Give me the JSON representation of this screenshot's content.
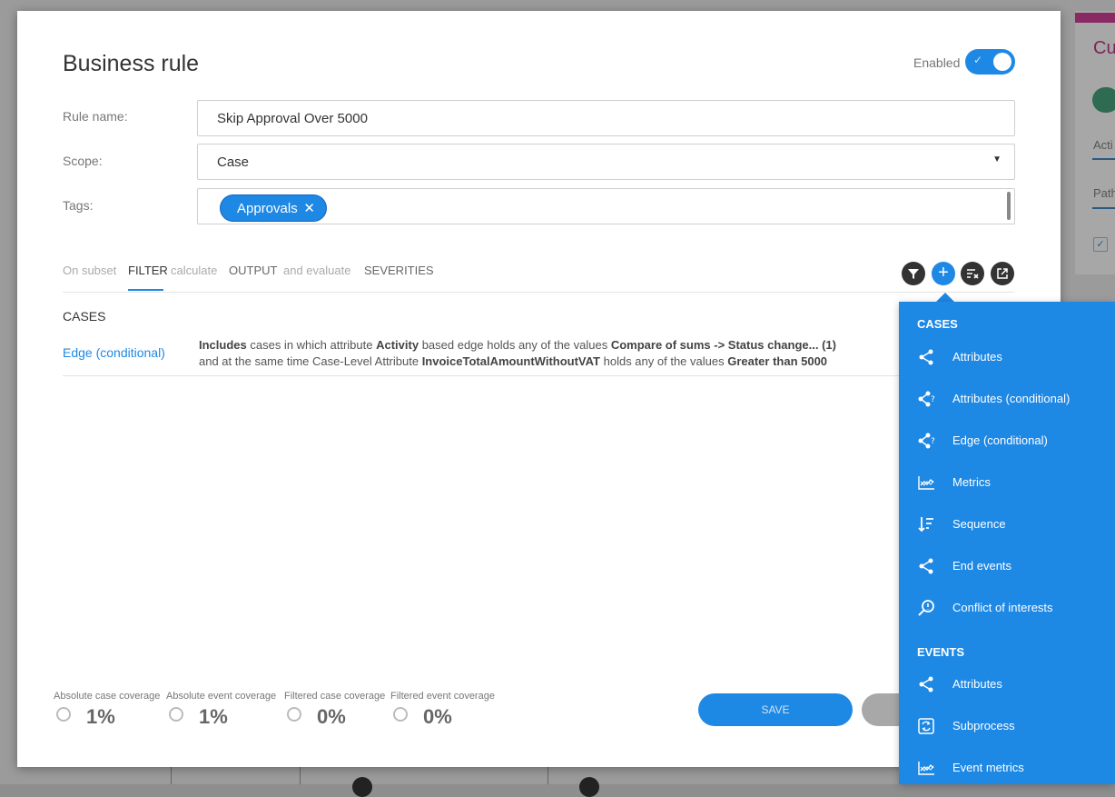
{
  "dialog": {
    "title": "Business rule",
    "enabled_label": "Enabled",
    "enabled": true
  },
  "form": {
    "rule_name_label": "Rule name:",
    "rule_name_value": "Skip Approval Over 5000",
    "scope_label": "Scope:",
    "scope_value": "Case",
    "tags_label": "Tags:",
    "tags": [
      "Approvals"
    ]
  },
  "tabs": [
    "On subset",
    "FILTER",
    "calculate",
    "OUTPUT",
    "and evaluate",
    "SEVERITIES"
  ],
  "active_tab": "FILTER",
  "filter_section": {
    "heading": "CASES",
    "rule": {
      "type_link": "Edge (conditional)",
      "line1": [
        {
          "t": "Includes",
          "b": true
        },
        {
          "t": " cases in which attribute ",
          "b": false
        },
        {
          "t": "Activity",
          "b": true
        },
        {
          "t": " based edge holds any of the values ",
          "b": false
        },
        {
          "t": "Compare of sums -> Status change... (1)",
          "b": true
        }
      ],
      "line2": [
        {
          "t": "and at the same time Case-Level Attribute ",
          "b": false
        },
        {
          "t": "InvoiceTotalAmountWithoutVAT",
          "b": true
        },
        {
          "t": " holds any of the values ",
          "b": false
        },
        {
          "t": "Greater than 5000",
          "b": true
        }
      ]
    }
  },
  "coverage": [
    {
      "caption": "Absolute case coverage",
      "value": "1%"
    },
    {
      "caption": "Absolute event coverage",
      "value": "1%"
    },
    {
      "caption": "Filtered case coverage",
      "value": "0%"
    },
    {
      "caption": "Filtered event coverage",
      "value": "0%"
    }
  ],
  "buttons": {
    "save": "SAVE"
  },
  "menu": {
    "cases_heading": "CASES",
    "cases_items": [
      {
        "label": "Attributes",
        "icon": "share-icon"
      },
      {
        "label": "Attributes (conditional)",
        "icon": "share-question-icon"
      },
      {
        "label": "Edge (conditional)",
        "icon": "share-question-icon"
      },
      {
        "label": "Metrics",
        "icon": "metrics-chart-icon"
      },
      {
        "label": "Sequence",
        "icon": "sort-sequence-icon"
      },
      {
        "label": "End events",
        "icon": "share-icon"
      },
      {
        "label": "Conflict of interests",
        "icon": "search-key-icon"
      }
    ],
    "events_heading": "EVENTS",
    "events_items": [
      {
        "label": "Attributes",
        "icon": "share-icon"
      },
      {
        "label": "Subprocess",
        "icon": "subprocess-icon"
      },
      {
        "label": "Event metrics",
        "icon": "metrics-chart-icon"
      }
    ]
  },
  "background": {
    "panel_title_fragment": "Cu",
    "tab1_fragment": "Acti",
    "tab2_fragment": "Path"
  },
  "colors": {
    "accent": "#1e88e5",
    "text": "#333333",
    "muted": "#aaaaaa"
  }
}
